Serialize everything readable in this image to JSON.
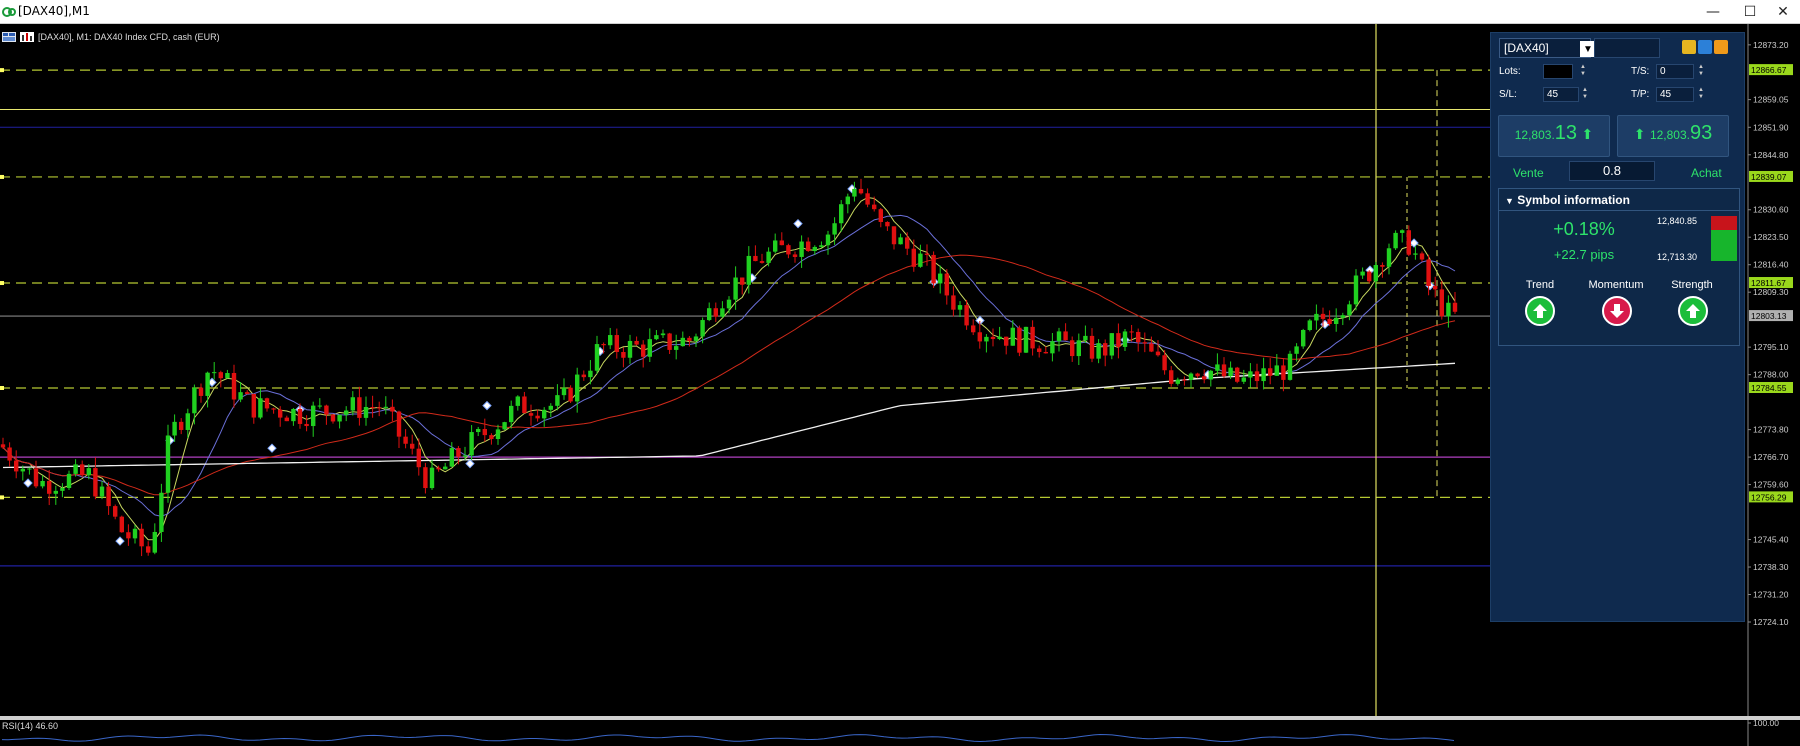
{
  "window": {
    "title": "[DAX40],M1",
    "minimize_glyph": "—",
    "maximize_glyph": "☐",
    "close_glyph": "✕"
  },
  "chart": {
    "header_text": "[DAX40], M1:  DAX40 Index CFD, cash (EUR)",
    "rsi_label": "RSI(14) 46.60",
    "price_ticks": [
      "12873.20",
      "12866.67",
      "12859.05",
      "12851.90",
      "12844.80",
      "12839.07",
      "12830.60",
      "12823.50",
      "12816.40",
      "12811.67",
      "12809.30",
      "12803.13",
      "12795.10",
      "12788.00",
      "12784.55",
      "12773.80",
      "12766.70",
      "12759.60",
      "12756.29",
      "12745.40",
      "12738.30",
      "12731.20",
      "12724.10",
      "100.00"
    ],
    "highlighted_prices": {
      "level_1": "12866.67",
      "level_2": "12839.07",
      "level_3": "12811.67",
      "current": "12803.13",
      "level_4": "12784.55",
      "level_5": "12756.29"
    },
    "colors": {
      "bull": "#20d020",
      "bear": "#e01010",
      "dashed_level": "#b5c832",
      "ma_fast": "#c8d860",
      "ma_mid": "#6a6fd8",
      "ma_slow": "#d02a1a",
      "ma_long": "#f0f0f0",
      "vline": "#e0e060",
      "magenta_line": "#b040c0",
      "blue_line": "#2020a0"
    }
  },
  "chart_data": {
    "type": "candlestick",
    "title": "[DAX40], M1:  DAX40 Index CFD, cash (EUR)",
    "ylim": [
      12721,
      12876
    ],
    "horizontal_levels": [
      12866.67,
      12839.07,
      12811.67,
      12784.55,
      12756.29
    ],
    "current_price": 12803.13,
    "rsi": 46.6
  },
  "panel": {
    "symbol": "[DAX40]",
    "lots_label": "Lots:",
    "lots_value": "",
    "ts_label": "T/S:",
    "ts_value": "0",
    "sl_label": "S/L:",
    "sl_value": "45",
    "tp_label": "T/P:",
    "tp_value": "45",
    "sell": {
      "price_small": "12,803.",
      "price_big": "13",
      "label": "Vente"
    },
    "buy": {
      "price_small": "12,803.",
      "price_big": "93",
      "label": "Achat"
    },
    "spread": "0.8",
    "symbol_info": {
      "header": "Symbol information",
      "change_pct": "+0.18%",
      "change_pips": "+22.7 pips",
      "high": "12,840.85",
      "low": "12,713.30",
      "trend_label": "Trend",
      "momentum_label": "Momentum",
      "strength_label": "Strength",
      "trend": "up",
      "momentum": "down",
      "strength": "up"
    }
  }
}
